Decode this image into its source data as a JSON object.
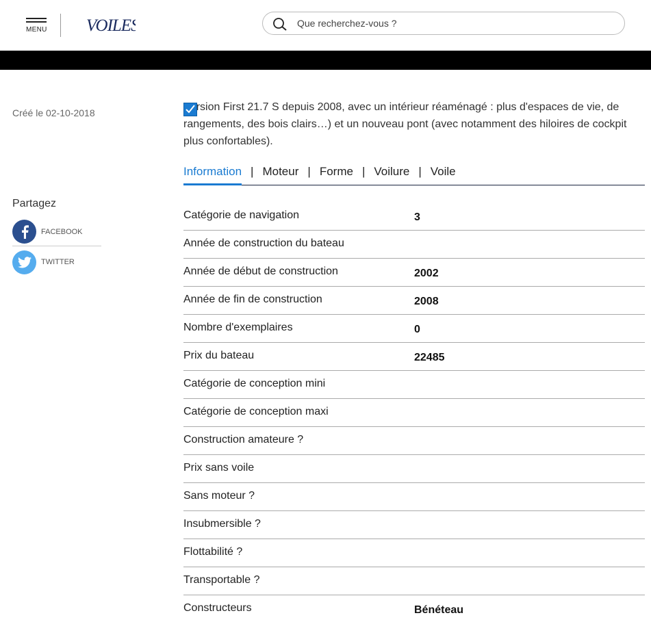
{
  "header": {
    "menu_label": "MENU",
    "logo_text": "VOILES",
    "search_placeholder": "Que recherchez-vous ?"
  },
  "meta": {
    "created": "Créé le 02-10-2018"
  },
  "share": {
    "title": "Partagez",
    "items": [
      {
        "label": "FACEBOOK",
        "icon": "facebook-icon",
        "color": "#2b4f8f"
      },
      {
        "label": "TWITTER",
        "icon": "twitter-icon",
        "color": "#55acee"
      }
    ]
  },
  "description": "Version First 21.7 S depuis 2008, avec un intérieur réaménagé : plus d'espaces de vie, de rangements, des bois clairs…) et un nouveau pont (avec notamment des hiloires de cockpit plus confortables).",
  "tabs": [
    {
      "label": "Information",
      "active": true
    },
    {
      "label": "Moteur",
      "active": false
    },
    {
      "label": "Forme",
      "active": false
    },
    {
      "label": "Voilure",
      "active": false
    },
    {
      "label": "Voile",
      "active": false
    }
  ],
  "tab_separator": "|",
  "specs": [
    {
      "key": "Catégorie de navigation",
      "value": "3"
    },
    {
      "key": "Année de construction du bateau",
      "value": ""
    },
    {
      "key": "Année de début de construction",
      "value": "2002"
    },
    {
      "key": "Année de fin de construction",
      "value": "2008"
    },
    {
      "key": "Nombre d'exemplaires",
      "value": "0"
    },
    {
      "key": "Prix du bateau",
      "value": "22485"
    },
    {
      "key": "Catégorie de conception mini",
      "value": ""
    },
    {
      "key": "Catégorie de conception maxi",
      "value": ""
    },
    {
      "key": "Construction amateure ?",
      "value": ""
    },
    {
      "key": "Prix sans voile",
      "value": ""
    },
    {
      "key": "Sans moteur ?",
      "value": ""
    },
    {
      "key": "Insubmersible ?",
      "value": ""
    },
    {
      "key": "Flottabilité ?",
      "value": ""
    },
    {
      "key": "Transportable ?",
      "value": ""
    },
    {
      "key": "Constructeurs",
      "value": "Bénéteau"
    }
  ],
  "colors": {
    "accent": "#1a7bd1",
    "black_band": "#000000"
  }
}
